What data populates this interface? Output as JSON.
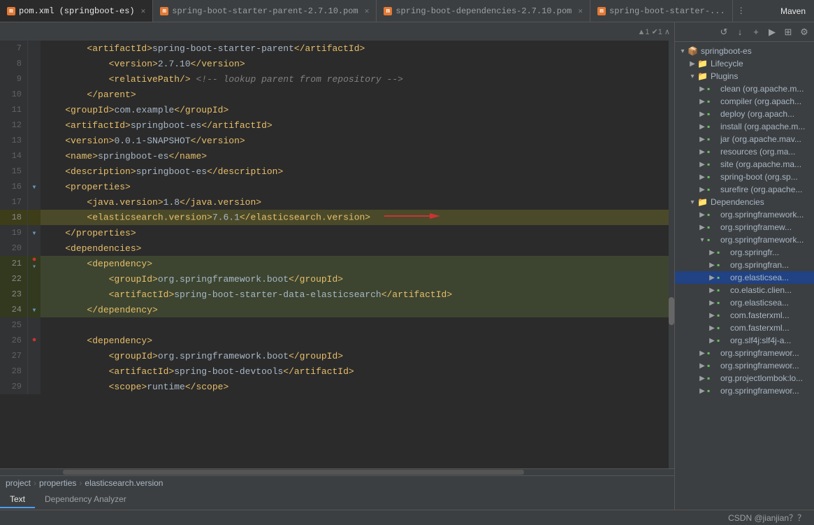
{
  "tabs": [
    {
      "id": "tab1",
      "icon": "m",
      "label": "pom.xml (springboot-es)",
      "active": true,
      "closable": true
    },
    {
      "id": "tab2",
      "icon": "m",
      "label": "spring-boot-starter-parent-2.7.10.pom",
      "active": false,
      "closable": true
    },
    {
      "id": "tab3",
      "icon": "m",
      "label": "spring-boot-dependencies-2.7.10.pom",
      "active": false,
      "closable": true
    },
    {
      "id": "tab4",
      "icon": "m",
      "label": "spring-boot-starter-...",
      "active": false,
      "closable": false
    }
  ],
  "maven_label": "Maven",
  "toolbar": {
    "refresh_icon": "↺",
    "download_icon": "↓",
    "plus_icon": "+",
    "run_icon": "▶",
    "expand_icon": "⊞",
    "settings_icon": "⚙"
  },
  "lines": [
    {
      "num": 7,
      "indent": 2,
      "content_parts": [
        {
          "type": "tag",
          "text": "<artifactId>"
        },
        {
          "type": "text",
          "text": "spring-boot-starter-parent"
        },
        {
          "type": "tag",
          "text": "</artifactId>"
        }
      ],
      "gutter": ""
    },
    {
      "num": 8,
      "indent": 3,
      "content_parts": [
        {
          "type": "tag",
          "text": "<version>"
        },
        {
          "type": "text",
          "text": "2.7.10"
        },
        {
          "type": "tag",
          "text": "</version>"
        }
      ],
      "gutter": ""
    },
    {
      "num": 9,
      "indent": 3,
      "content_parts": [
        {
          "type": "tag",
          "text": "<relativePath/>"
        },
        {
          "type": "comment",
          "text": " <!-- lookup parent from repository -->"
        }
      ],
      "gutter": ""
    },
    {
      "num": 10,
      "indent": 2,
      "content_parts": [
        {
          "type": "tag",
          "text": "</parent>"
        }
      ],
      "gutter": ""
    },
    {
      "num": 11,
      "indent": 1,
      "content_parts": [
        {
          "type": "tag",
          "text": "<groupId>"
        },
        {
          "type": "text",
          "text": "com.example"
        },
        {
          "type": "tag",
          "text": "</groupId>"
        }
      ],
      "gutter": ""
    },
    {
      "num": 12,
      "indent": 1,
      "content_parts": [
        {
          "type": "tag",
          "text": "<artifactId>"
        },
        {
          "type": "text",
          "text": "springboot-es"
        },
        {
          "type": "tag",
          "text": "</artifactId>"
        }
      ],
      "gutter": ""
    },
    {
      "num": 13,
      "indent": 1,
      "content_parts": [
        {
          "type": "tag",
          "text": "<version>"
        },
        {
          "type": "text",
          "text": "0.0.1-SNAPSHOT"
        },
        {
          "type": "tag",
          "text": "</version>"
        }
      ],
      "gutter": ""
    },
    {
      "num": 14,
      "indent": 1,
      "content_parts": [
        {
          "type": "tag",
          "text": "<name>"
        },
        {
          "type": "text",
          "text": "springboot-es"
        },
        {
          "type": "tag",
          "text": "</name>"
        }
      ],
      "gutter": ""
    },
    {
      "num": 15,
      "indent": 1,
      "content_parts": [
        {
          "type": "tag",
          "text": "<description>"
        },
        {
          "type": "text",
          "text": "springboot-es"
        },
        {
          "type": "tag",
          "text": "</description>"
        }
      ],
      "gutter": ""
    },
    {
      "num": 16,
      "indent": 1,
      "content_parts": [
        {
          "type": "tag",
          "text": "<properties>"
        }
      ],
      "gutter": "fold"
    },
    {
      "num": 17,
      "indent": 2,
      "content_parts": [
        {
          "type": "tag",
          "text": "<java.version>"
        },
        {
          "type": "text",
          "text": "1.8"
        },
        {
          "type": "tag",
          "text": "</java.version>"
        }
      ],
      "gutter": ""
    },
    {
      "num": 18,
      "indent": 2,
      "content_parts": [
        {
          "type": "tag",
          "text": "<elasticsearch.version>"
        },
        {
          "type": "text",
          "text": "7.6.1"
        },
        {
          "type": "tag",
          "text": "</elasticsearch.version>"
        }
      ],
      "gutter": "",
      "highlighted": true,
      "arrow": true
    },
    {
      "num": 19,
      "indent": 1,
      "content_parts": [
        {
          "type": "tag",
          "text": "</properties>"
        }
      ],
      "gutter": "fold"
    },
    {
      "num": 20,
      "indent": 1,
      "content_parts": [
        {
          "type": "tag",
          "text": "<dependencies>"
        }
      ],
      "gutter": ""
    },
    {
      "num": 21,
      "indent": 2,
      "content_parts": [
        {
          "type": "tag",
          "text": "<dependency>"
        }
      ],
      "gutter": "fold",
      "selected": true,
      "error": true
    },
    {
      "num": 22,
      "indent": 3,
      "content_parts": [
        {
          "type": "tag",
          "text": "<groupId>"
        },
        {
          "type": "text",
          "text": "org.springframework.boot"
        },
        {
          "type": "tag",
          "text": "</groupId>"
        }
      ],
      "gutter": "",
      "selected": true
    },
    {
      "num": 23,
      "indent": 3,
      "content_parts": [
        {
          "type": "tag",
          "text": "<artifactId>"
        },
        {
          "type": "text",
          "text": "spring-boot-starter-data-elasticsearch"
        },
        {
          "type": "tag",
          "text": "</artifactId>"
        }
      ],
      "gutter": "",
      "selected": true
    },
    {
      "num": 24,
      "indent": 2,
      "content_parts": [
        {
          "type": "tag",
          "text": "</dependency>"
        }
      ],
      "gutter": "fold",
      "selected": true
    },
    {
      "num": 25,
      "indent": 0,
      "content_parts": [],
      "gutter": ""
    },
    {
      "num": 26,
      "indent": 2,
      "content_parts": [
        {
          "type": "tag",
          "text": "<dependency>"
        }
      ],
      "gutter": "fold",
      "error": true
    },
    {
      "num": 27,
      "indent": 3,
      "content_parts": [
        {
          "type": "tag",
          "text": "<groupId>"
        },
        {
          "type": "text",
          "text": "org.springframework.boot"
        },
        {
          "type": "tag",
          "text": "</groupId>"
        }
      ],
      "gutter": ""
    },
    {
      "num": 28,
      "indent": 3,
      "content_parts": [
        {
          "type": "tag",
          "text": "<artifactId>"
        },
        {
          "type": "text",
          "text": "spring-boot-devtools"
        },
        {
          "type": "tag",
          "text": "</artifactId>"
        }
      ],
      "gutter": ""
    },
    {
      "num": 29,
      "indent": 3,
      "content_parts": [
        {
          "type": "tag",
          "text": "<scope>"
        },
        {
          "type": "text",
          "text": "runtime"
        },
        {
          "type": "tag",
          "text": "</scope>"
        }
      ],
      "gutter": ""
    }
  ],
  "breadcrumb": {
    "items": [
      "project",
      "properties",
      "elasticsearch.version"
    ]
  },
  "bottom_tabs": [
    {
      "label": "Text",
      "active": true
    },
    {
      "label": "Dependency Analyzer",
      "active": false
    }
  ],
  "maven_tree": {
    "root": "springboot-es",
    "sections": [
      {
        "label": "Lifecycle",
        "icon": "folder",
        "expanded": true
      },
      {
        "label": "Plugins",
        "icon": "folder",
        "expanded": true,
        "children": [
          {
            "label": "clean (org.apache.m...",
            "icon": "dep"
          },
          {
            "label": "compiler (org.apach...",
            "icon": "dep"
          },
          {
            "label": "deploy (org.apach...",
            "icon": "dep"
          },
          {
            "label": "install (org.apache.m...",
            "icon": "dep"
          },
          {
            "label": "jar (org.apache.mav...",
            "icon": "dep"
          },
          {
            "label": "resources (org.ma...",
            "icon": "dep"
          },
          {
            "label": "site (org.apache.ma...",
            "icon": "dep"
          },
          {
            "label": "spring-boot (org.sp...",
            "icon": "dep"
          },
          {
            "label": "surefire (org.apache...",
            "icon": "dep"
          }
        ]
      },
      {
        "label": "Dependencies",
        "icon": "folder",
        "expanded": true,
        "children": [
          {
            "label": "org.springframework...",
            "icon": "dep"
          },
          {
            "label": "org.springframew...",
            "icon": "dep"
          },
          {
            "label": "org.springframework...",
            "icon": "dep",
            "expanded": true,
            "children": [
              {
                "label": "org.springfr...",
                "icon": "dep"
              },
              {
                "label": "org.springfran...",
                "icon": "dep"
              },
              {
                "label": "org.elasticsea...",
                "icon": "dep",
                "active": true
              },
              {
                "label": "co.elastic.clien...",
                "icon": "dep"
              },
              {
                "label": "org.elasticsea...",
                "icon": "dep"
              },
              {
                "label": "com.fasterxml...",
                "icon": "dep"
              },
              {
                "label": "com.fasterxml...",
                "icon": "dep"
              },
              {
                "label": "org.slf4j:slf4j-a...",
                "icon": "dep"
              }
            ]
          },
          {
            "label": "org.springframewor...",
            "icon": "dep"
          },
          {
            "label": "org.springframewor...",
            "icon": "dep"
          },
          {
            "label": "org.projectlombok:lo...",
            "icon": "dep"
          },
          {
            "label": "org.springframewor...",
            "icon": "dep"
          }
        ]
      }
    ]
  },
  "status_bar": {
    "text": "CSDN @jianjian？？"
  }
}
